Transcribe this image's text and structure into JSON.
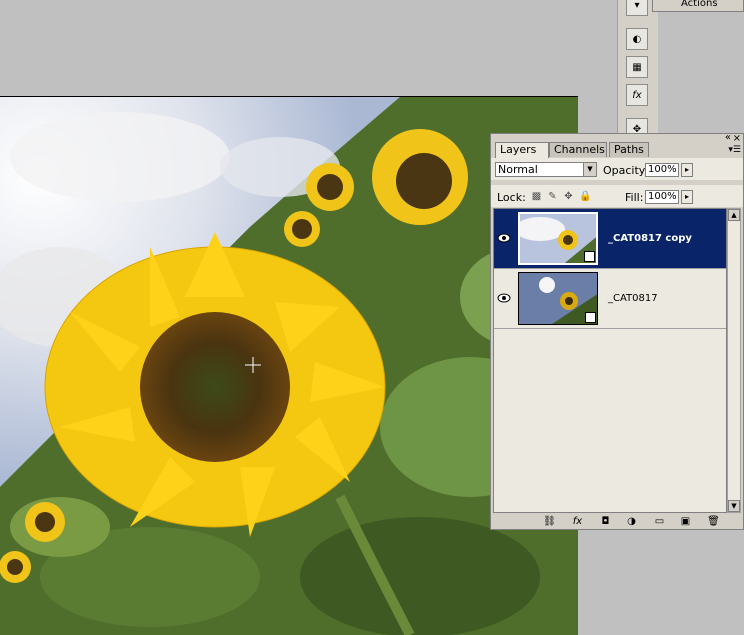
{
  "actions_tab": {
    "label": "Actions"
  },
  "dock": {
    "icons": [
      "brush-icon",
      "palette-icon",
      "grid-icon",
      "fx-icon",
      "move-icon"
    ]
  },
  "layers_panel": {
    "tabs": [
      {
        "label": "Layers",
        "active": true,
        "close": "×"
      },
      {
        "label": "Channels",
        "active": false
      },
      {
        "label": "Paths",
        "active": false
      }
    ],
    "blend_mode": "Normal",
    "opacity_label": "Opacity:",
    "opacity_value": "100%",
    "lock_label": "Lock:",
    "fill_label": "Fill:",
    "fill_value": "100%",
    "layers": [
      {
        "name": "_CAT0817 copy",
        "selected": true,
        "visible": true
      },
      {
        "name": "_CAT0817",
        "selected": false,
        "visible": true
      }
    ],
    "footer_icons": [
      "link-icon",
      "fx-icon",
      "mask-icon",
      "adjustment-icon",
      "group-icon",
      "new-layer-icon",
      "trash-icon"
    ]
  },
  "colors": {
    "selection": "#0a246a",
    "panel_bg": "#d4d0c8",
    "workspace": "#c0c0c0"
  }
}
